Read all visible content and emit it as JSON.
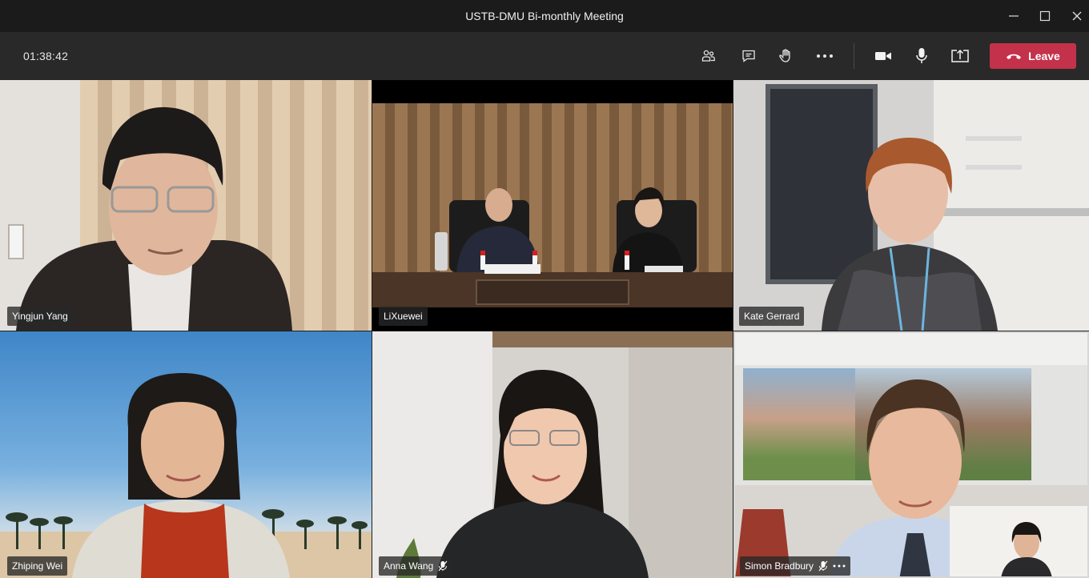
{
  "window": {
    "title": "USTB-DMU Bi-monthly Meeting",
    "controls": [
      "minimize-icon",
      "maximize-icon",
      "close-icon"
    ]
  },
  "toolbar": {
    "timer": "01:38:42",
    "buttons": [
      "participants-icon",
      "chat-icon",
      "raise-hand-icon",
      "more-options-icon",
      "camera-icon",
      "microphone-icon",
      "share-screen-icon"
    ],
    "leave_label": "Leave",
    "leave_color": "#c4314b"
  },
  "participants": [
    {
      "name": "Yingjun Yang",
      "muted": false
    },
    {
      "name": "LiXuewei",
      "muted": false
    },
    {
      "name": "Kate Gerrard",
      "muted": false
    },
    {
      "name": "Zhiping Wei",
      "muted": false
    },
    {
      "name": "Anna Wang",
      "muted": true
    },
    {
      "name": "Simon Bradbury",
      "muted": true,
      "more_options": true
    }
  ]
}
